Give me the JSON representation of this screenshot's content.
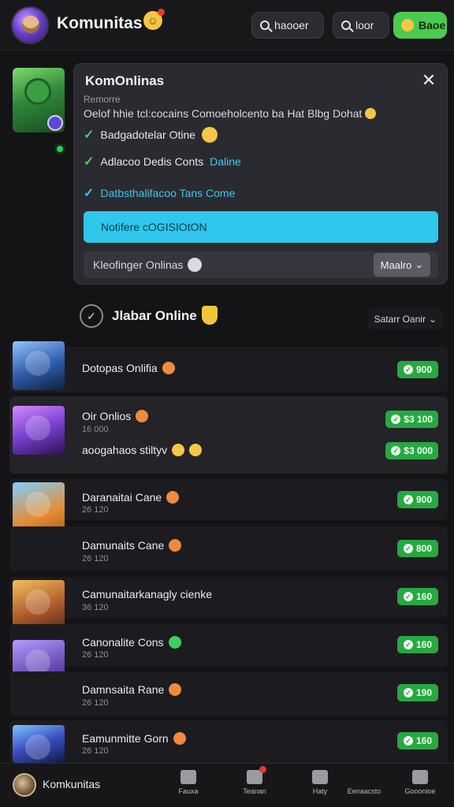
{
  "header": {
    "title": "Komunitas",
    "search1": "haooer",
    "search2": "loor",
    "green_button": "Baoe"
  },
  "popup": {
    "title": "KomOnlinas",
    "subtitle": "Remorre",
    "description": "Oelof hhie tcl:cocains Comoeholcento ba Hat Blbg Dohat",
    "checks": [
      {
        "text": "Badgadotelar Otine",
        "highlight": ""
      },
      {
        "text": "Adlacoo Dedis Conts",
        "highlight": "Daline"
      },
      {
        "text": "Datbsthalifacoo Tans Come",
        "highlight": ""
      }
    ],
    "cta": "Notifere cOGISIOtON",
    "row_label": "Kleofinger Onlinas",
    "row_button": "Maalro"
  },
  "section": {
    "title": "Jlabar Online",
    "sort": "Satarr Oanir"
  },
  "list": [
    {
      "name": "Dotopas Onlifia",
      "sub": "",
      "badge": "900"
    },
    {
      "name": "Oir Onlios",
      "sub": "16 000",
      "badge": "$3 100"
    },
    {
      "name": "aoogahaos stiltyv",
      "sub": "",
      "badge": "$3 000"
    },
    {
      "name": "Daranaitai Cane",
      "sub": "26 120",
      "badge": "900"
    },
    {
      "name": "Damunaits Cane",
      "sub": "26 120",
      "badge": "800"
    },
    {
      "name": "Camunaitarkanagly cienke",
      "sub": "36 120",
      "badge": "160"
    },
    {
      "name": "Canonalite Cons",
      "sub": "26 120",
      "badge": "160"
    },
    {
      "name": "Damnsaita Rane",
      "sub": "26 120",
      "badge": "190"
    },
    {
      "name": "Eamunmitte Gorn",
      "sub": "26 120",
      "badge": "160"
    }
  ],
  "bottom_nav": {
    "title": "Komkunitas",
    "items": [
      "Fauxa",
      "Teanan",
      "Haty",
      "Eenaacsto",
      "Gooonioe"
    ]
  },
  "colors": {
    "accent_green": "#4cc94f",
    "badge_green": "#27a843",
    "cta_cyan": "#2fc7ec",
    "background": "#141416"
  }
}
